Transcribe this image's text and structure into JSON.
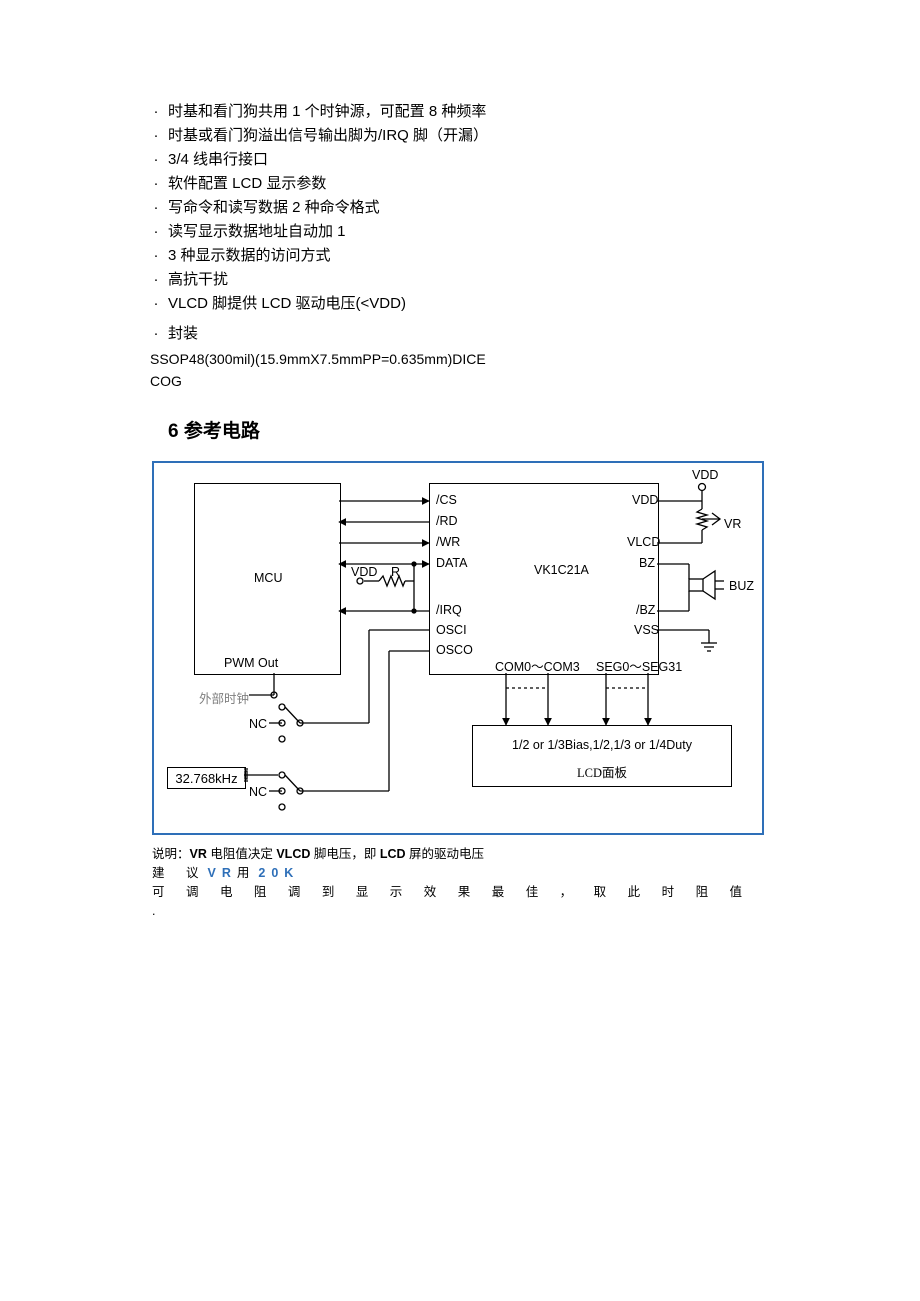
{
  "bullets": [
    "时基和看门狗共用 1 个时钟源，可配置 8 种频率",
    "时基或看门狗溢出信号输出脚为/IRQ 脚（开漏）",
    "3/4 线串行接口",
    "软件配置 LCD 显示参数",
    "写命令和读写数据 2 种命令格式",
    "读写显示数据地址自动加 1",
    "3 种显示数据的访问方式",
    "高抗干扰",
    "VLCD 脚提供 LCD 驱动电压(<VDD)",
    "封装"
  ],
  "package_line1": "SSOP48(300mil)(15.9mmX7.5mmPP=0.635mm)DICE",
  "package_line2": "COG",
  "section_title": "6 参考电路",
  "dot": "·",
  "diagram": {
    "mcu": "MCU",
    "chip": "VK1C21A",
    "pwm": "PWM Out",
    "ext_clk": "外部时钟",
    "nc": "NC",
    "osc": "32.768kHz",
    "sig_cs": "/CS",
    "sig_rd": "/RD",
    "sig_wr": "/WR",
    "sig_data": "DATA",
    "sig_irq": "/IRQ",
    "sig_osci": "OSCI",
    "sig_osco": "OSCO",
    "vdd_s": "VDD",
    "r_s": "R",
    "right_vdd_top": "VDD",
    "right_vdd": "VDD",
    "right_vlcd": "VLCD",
    "right_bz": "BZ",
    "right_nbz": "/BZ",
    "right_vss": "VSS",
    "vr": "VR",
    "buz": "BUZ",
    "com": "COM0～COM3",
    "seg": "SEG0～SEG31",
    "lcd_line1": "1/2 or 1/3Bias,1/2,1/3 or 1/4Duty",
    "lcd_line2": "LCD面板"
  },
  "notes": {
    "line1_pre": "说明：",
    "line1_vr": "VR",
    "line1_mid1": " 电阻值决定 ",
    "line1_vlcd": "VLCD",
    "line1_mid2": " 脚电压，即 ",
    "line1_lcd": "LCD",
    "line1_tail": " 屏的驱动电压",
    "line2_pre": "建 议 ",
    "line2_vr": "VR",
    "line2_mid": " 用 ",
    "line2_20k": "20K",
    "line2_tail": " 可 调 电 阻 调 到 显 示 效 果 最 佳 ， 取 此 时 阻 值 ."
  }
}
